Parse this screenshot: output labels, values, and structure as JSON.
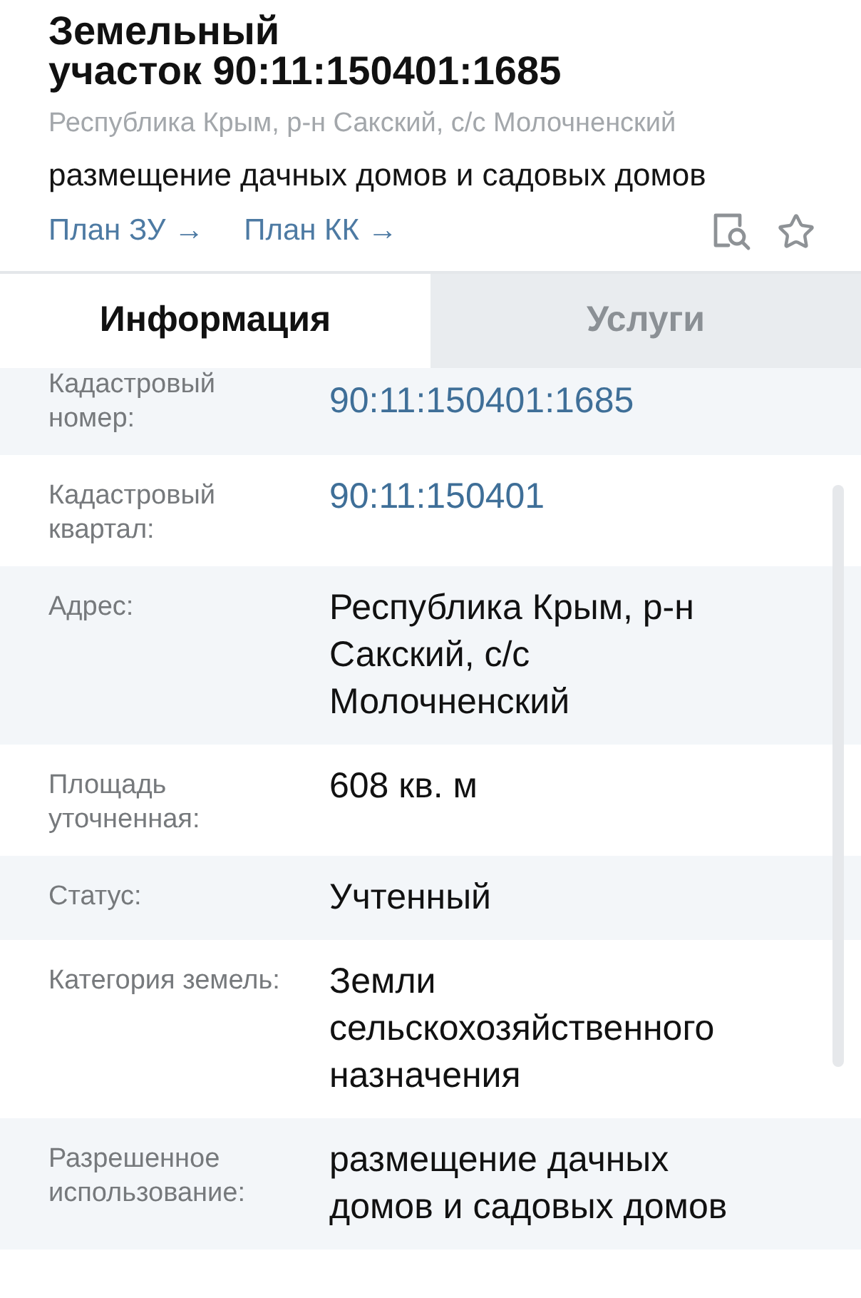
{
  "header": {
    "title": "Земельный участок 90:11:150401:1685",
    "address": "Республика Крым, р-н Сакский, с/с Молочненский",
    "usage": "размещение дачных домов и садовых домов",
    "links": [
      "План ЗУ →",
      "План КК →"
    ]
  },
  "tabs": [
    {
      "label": "Информация",
      "selected": true
    },
    {
      "label": "Услуги",
      "selected": false
    }
  ],
  "rows": [
    {
      "label": "Кадастровый номер:",
      "value": "90:11:150401:1685",
      "kind": "link"
    },
    {
      "label": "Кадастровый квартал:",
      "value": "90:11:150401",
      "kind": "link"
    },
    {
      "label": "Адрес:",
      "value": "Республика Крым, р-н Сакский, с/с Молочненский",
      "kind": "text"
    },
    {
      "label": "Площадь уточненная:",
      "value": "608 кв. м",
      "kind": "text"
    },
    {
      "label": "Статус:",
      "value": "Учтенный",
      "kind": "text"
    },
    {
      "label": "Категория земель:",
      "value": "Земли сельскохозяйственного назначения",
      "kind": "text"
    },
    {
      "label": "Разрешенное использование:",
      "value": "размещение дачных домов и садовых домов",
      "kind": "text"
    }
  ]
}
